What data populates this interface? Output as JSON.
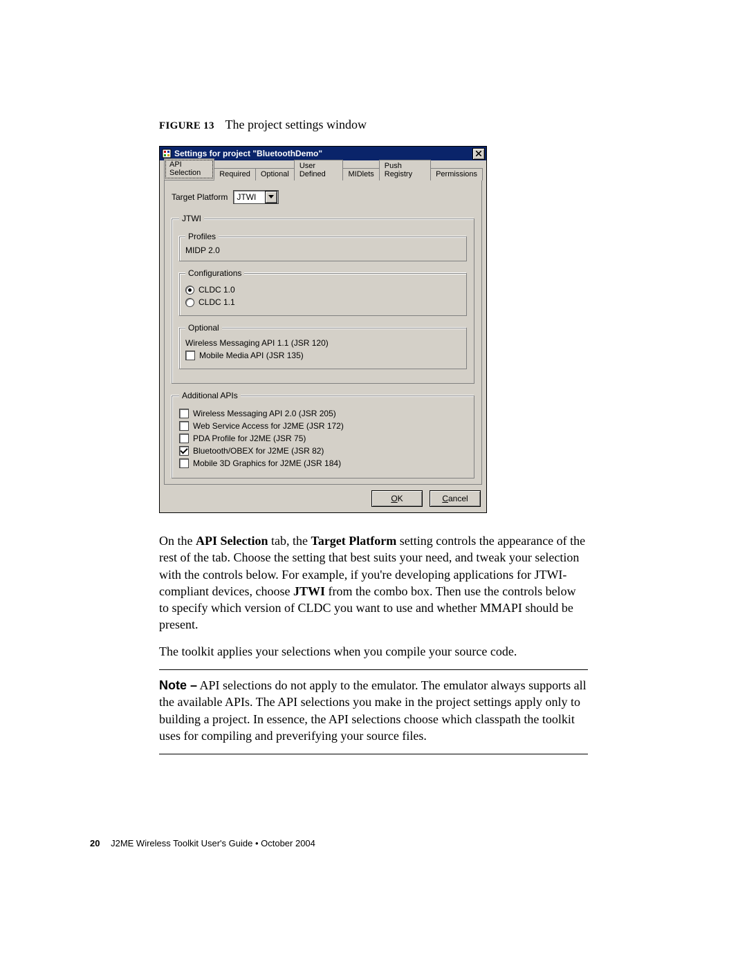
{
  "figure": {
    "number": "FIGURE 13",
    "caption": "The project settings window"
  },
  "dialog": {
    "title": "Settings for project \"BluetoothDemo\"",
    "tabs": [
      "API Selection",
      "Required",
      "Optional",
      "User Defined",
      "MIDlets",
      "Push Registry",
      "Permissions"
    ],
    "active_tab": 0,
    "target_platform_label": "Target Platform",
    "target_platform_value": "JTWI",
    "jtwi_legend": "JTWI",
    "profiles": {
      "legend": "Profiles",
      "value": "MIDP 2.0"
    },
    "configurations": {
      "legend": "Configurations",
      "options": [
        {
          "label": "CLDC 1.0",
          "selected": true
        },
        {
          "label": "CLDC 1.1",
          "selected": false
        }
      ]
    },
    "optional": {
      "legend": "Optional",
      "static_line": "Wireless Messaging API 1.1 (JSR 120)",
      "items": [
        {
          "label": "Mobile Media API (JSR 135)",
          "checked": false
        }
      ]
    },
    "additional": {
      "legend": "Additional APIs",
      "items": [
        {
          "label": "Wireless Messaging API 2.0 (JSR 205)",
          "checked": false
        },
        {
          "label": "Web Service Access for J2ME (JSR 172)",
          "checked": false
        },
        {
          "label": "PDA Profile for J2ME (JSR 75)",
          "checked": false
        },
        {
          "label": "Bluetooth/OBEX for J2ME (JSR 82)",
          "checked": true
        },
        {
          "label": "Mobile 3D Graphics for J2ME (JSR 184)",
          "checked": false
        }
      ]
    },
    "buttons": {
      "ok": "OK",
      "cancel": "Cancel"
    }
  },
  "body": {
    "p1a": "On the ",
    "p1b": "API Selection",
    "p1c": " tab, the ",
    "p1d": "Target Platform",
    "p1e": " setting controls the appearance of the rest of the tab. Choose the setting that best suits your need, and tweak your selection with the controls below. For example, if you're developing applications for JTWI-compliant devices, choose ",
    "p1f": "JTWI",
    "p1g": " from the combo box. Then use the controls below to specify which version of CLDC you want to use and whether MMAPI should be present.",
    "p2": "The toolkit applies your selections when you compile your source code.",
    "note_label": "Note –",
    "note_text": " API selections do not apply to the emulator. The emulator always supports all the available APIs. The API selections you make in the project settings apply only to building a project. In essence, the API selections choose which classpath the toolkit uses for compiling and preverifying your source files."
  },
  "footer": {
    "page": "20",
    "text": "J2ME Wireless Toolkit User's Guide • October 2004"
  }
}
